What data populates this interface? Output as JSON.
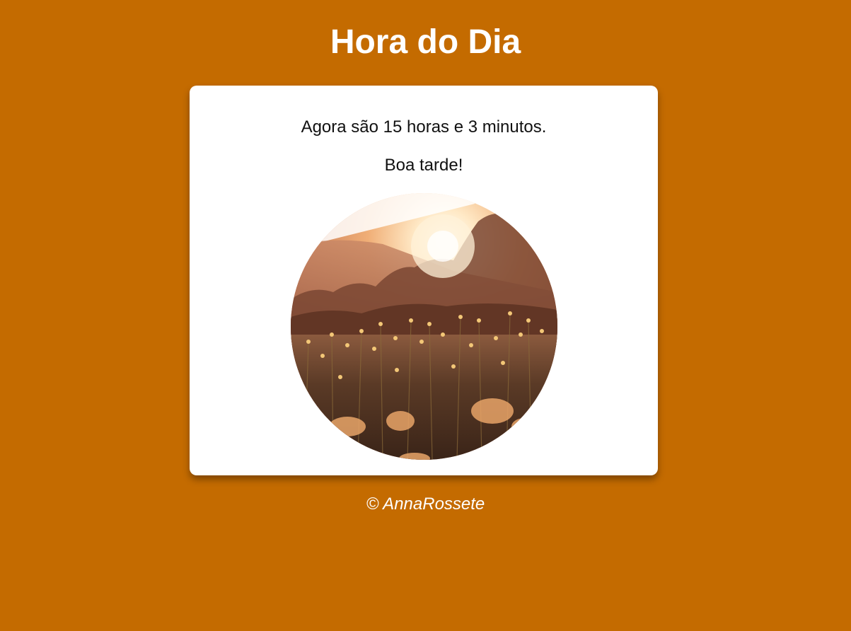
{
  "header": {
    "title": "Hora do Dia"
  },
  "card": {
    "time_message": "Agora são 15 horas e 3 minutos.",
    "greeting": "Boa tarde!",
    "image": {
      "subject": "sunset-wildflower-field",
      "palette": {
        "sky": "#fff6ec",
        "sun": "#ffd79a",
        "haze": "#d89060",
        "trees": "#6b3a2a",
        "field": "#4a3020",
        "flowers": "#f0b860"
      }
    }
  },
  "footer": {
    "credit": "© AnnaRossete"
  },
  "colors": {
    "background": "#c46b00",
    "card": "#ffffff",
    "text": "#111111",
    "header_text": "#ffffff"
  }
}
